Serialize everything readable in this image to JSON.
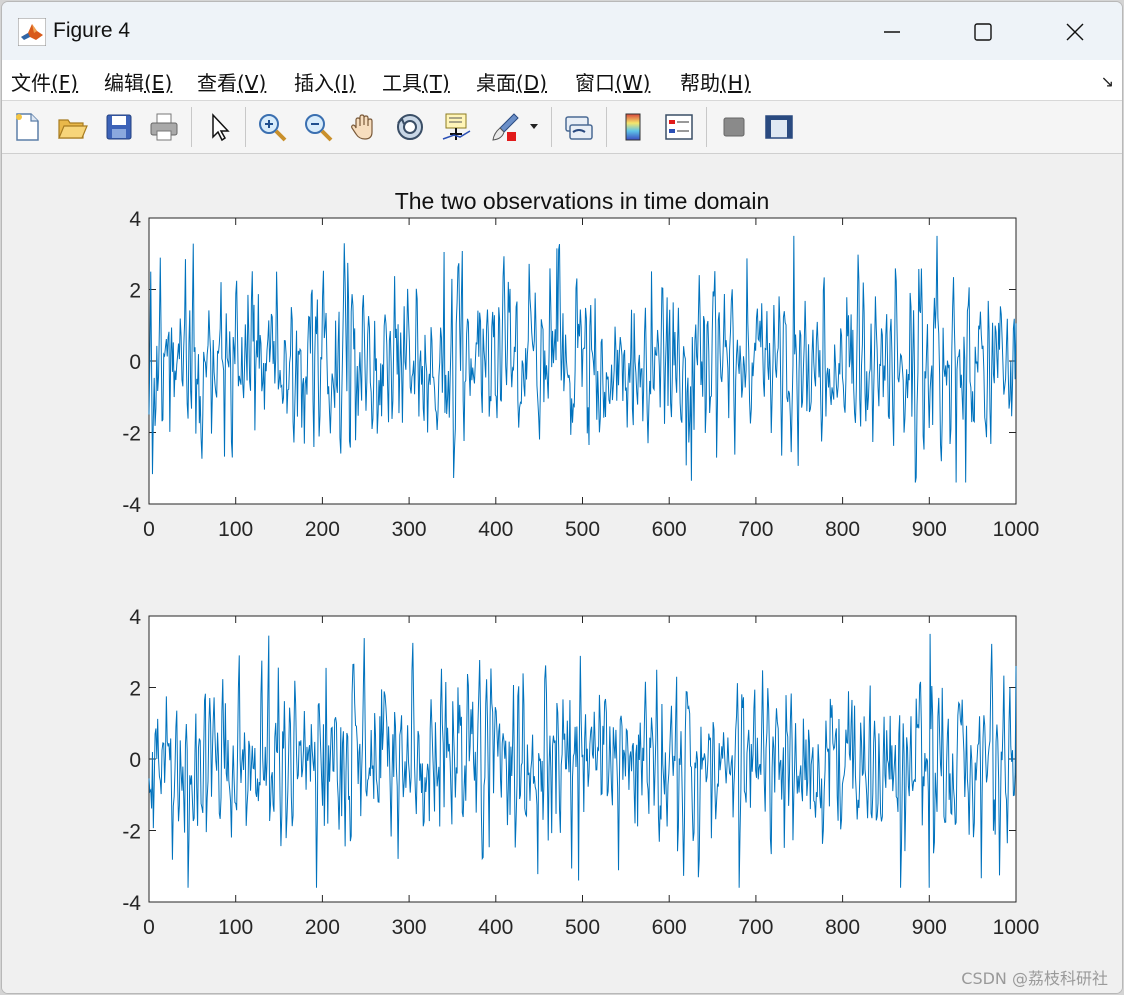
{
  "window": {
    "title": "Figure 4"
  },
  "menu": [
    {
      "label": "文件",
      "key": "(F)"
    },
    {
      "label": "编辑",
      "key": "(E)"
    },
    {
      "label": "查看",
      "key": "(V)"
    },
    {
      "label": "插入",
      "key": "(I)"
    },
    {
      "label": "工具",
      "key": "(T)"
    },
    {
      "label": "桌面",
      "key": "(D)"
    },
    {
      "label": "窗口",
      "key": "(W)"
    },
    {
      "label": "帮助",
      "key": "(H)"
    }
  ],
  "toolbar": {
    "icons": [
      "new-figure-icon",
      "open-icon",
      "save-icon",
      "print-icon",
      "edit-plot-arrow-icon",
      "zoom-in-icon",
      "zoom-out-icon",
      "pan-hand-icon",
      "rotate-3d-icon",
      "data-cursor-icon",
      "brush-icon",
      "link-plot-icon",
      "colorbar-icon",
      "legend-icon",
      "hide-tools-icon",
      "show-tools-icon"
    ]
  },
  "colors": {
    "series": "#0072bd",
    "axes_bg": "#ffffff",
    "figure_bg": "#f0f0f0"
  },
  "chart_data": [
    {
      "type": "line",
      "title": "The two observations in time domain",
      "xlabel": "",
      "ylabel": "",
      "xlim": [
        0,
        1000
      ],
      "ylim": [
        -4,
        4
      ],
      "xticks": [
        "0",
        "100",
        "200",
        "300",
        "400",
        "500",
        "600",
        "700",
        "800",
        "900",
        "1000"
      ],
      "yticks": [
        "-4",
        "-2",
        "0",
        "2",
        "4"
      ],
      "grid": false,
      "n_points": 1000,
      "series": [
        {
          "color": "#0072bd",
          "approx_range": [
            -3.4,
            3.5
          ],
          "peaks": [
            {
              "x": 2,
              "y": 2.5
            },
            {
              "x": 42,
              "y": 2.85
            },
            {
              "x": 340,
              "y": 3.05
            },
            {
              "x": 470,
              "y": 3.15
            },
            {
              "x": 743,
              "y": 3.5
            },
            {
              "x": 625,
              "y": -3.35
            },
            {
              "x": 930,
              "y": -3.4
            }
          ]
        }
      ]
    },
    {
      "type": "line",
      "title": "",
      "xlabel": "",
      "ylabel": "",
      "xlim": [
        0,
        1000
      ],
      "ylim": [
        -4,
        4
      ],
      "xticks": [
        "0",
        "100",
        "200",
        "300",
        "400",
        "500",
        "600",
        "700",
        "800",
        "900",
        "1000"
      ],
      "yticks": [
        "-4",
        "-2",
        "0",
        "2",
        "4"
      ],
      "grid": false,
      "n_points": 1000,
      "series": [
        {
          "color": "#0072bd",
          "approx_range": [
            -3.6,
            3.5
          ],
          "peaks": [
            {
              "x": 138,
              "y": 3.45
            },
            {
              "x": 900,
              "y": 3.5
            },
            {
              "x": 680,
              "y": -3.6
            },
            {
              "x": 495,
              "y": -3.4
            },
            {
              "x": 1000,
              "y": 2.6
            }
          ]
        }
      ]
    }
  ],
  "watermark": "CSDN @荔枝科研社"
}
